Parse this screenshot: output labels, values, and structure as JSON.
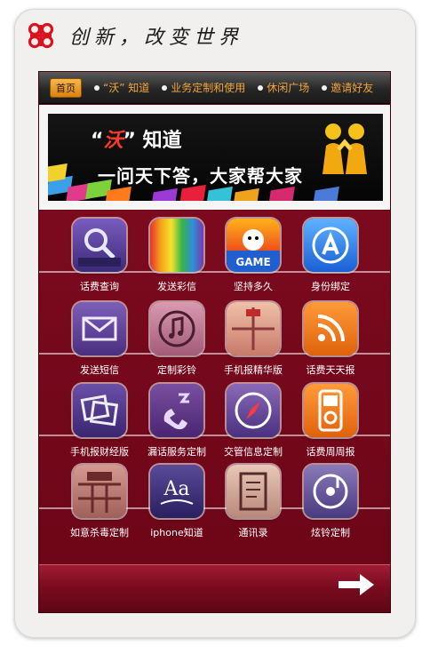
{
  "header": {
    "slogan": "创新，改变世界"
  },
  "nav": {
    "home": "首页",
    "items": [
      "“沃” 知道",
      "业务定制和使用",
      "休闲广场",
      "邀请好友"
    ]
  },
  "banner": {
    "title_open": "“",
    "title_highlight": "沃",
    "title_close": "” 知道",
    "subtitle": "一问天下答，大家帮大家"
  },
  "tiles": [
    {
      "label": "话费查询",
      "icon": "mms-viewer-icon"
    },
    {
      "label": "发送彩信",
      "icon": "rainbow-icon"
    },
    {
      "label": "坚持多久",
      "icon": "game-icon"
    },
    {
      "label": "身份绑定",
      "icon": "app-store-icon"
    },
    {
      "label": "发送短信",
      "icon": "envelope-icon"
    },
    {
      "label": "定制彩铃",
      "icon": "music-note-icon"
    },
    {
      "label": "手机报精华版",
      "icon": "newspaper-icon"
    },
    {
      "label": "话费天天报",
      "icon": "rss-icon"
    },
    {
      "label": "手机报财经版",
      "icon": "photos-icon"
    },
    {
      "label": "漏话服务定制",
      "icon": "missed-call-icon"
    },
    {
      "label": "交管信息定制",
      "icon": "compass-icon"
    },
    {
      "label": "话费周周报",
      "icon": "ipod-icon"
    },
    {
      "label": "如意杀毒定制",
      "icon": "antivirus-icon"
    },
    {
      "label": "iphone知道",
      "icon": "dictionary-icon"
    },
    {
      "label": "通讯录",
      "icon": "contacts-icon"
    },
    {
      "label": "炫铃定制",
      "icon": "ringtone-disc-icon"
    }
  ],
  "colors": {
    "screen_bg": "#6a0716",
    "nav_text": "#f4a53e",
    "accent_red": "#ff3a2a"
  }
}
